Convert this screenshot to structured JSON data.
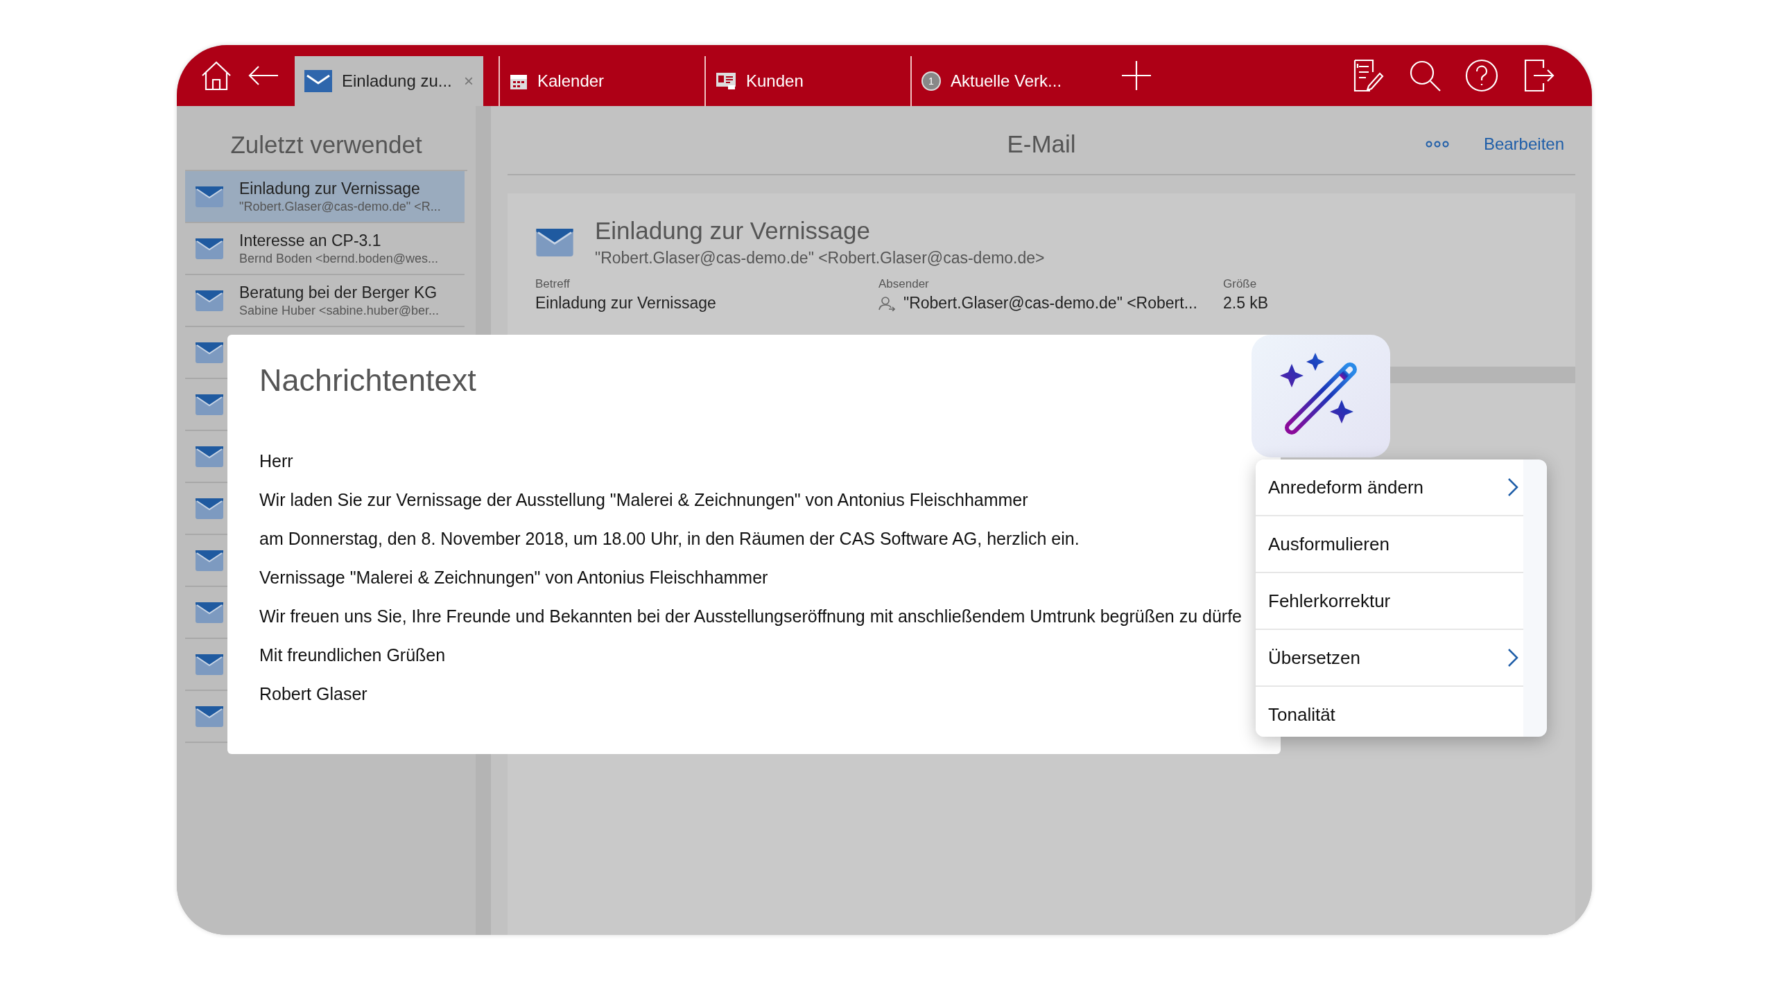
{
  "topbar": {
    "tabs": [
      {
        "label": "Einladung zu...",
        "kind": "mail",
        "selected": true,
        "close": "×"
      },
      {
        "label": "Kalender",
        "kind": "calendar",
        "selected": false
      },
      {
        "label": "Kunden",
        "kind": "card",
        "selected": false
      },
      {
        "label": "Aktuelle Verk...",
        "kind": "badge",
        "badge": "1",
        "selected": false
      }
    ]
  },
  "sidebar": {
    "title": "Zuletzt verwendet",
    "items": [
      {
        "title": "Einladung zur Vernissage",
        "subtitle": "\"Robert.Glaser@cas-demo.de\" <R...",
        "selected": true
      },
      {
        "title": "Interesse an CP-3.1",
        "subtitle": "Bernd Boden <bernd.boden@wes...",
        "selected": false
      },
      {
        "title": "Beratung bei der Berger KG",
        "subtitle": "Sabine Huber <sabine.huber@ber...",
        "selected": false
      },
      {
        "selected": false
      },
      {
        "selected": false
      },
      {
        "selected": false
      },
      {
        "selected": false
      },
      {
        "selected": false
      },
      {
        "selected": false
      },
      {
        "selected": false
      },
      {
        "selected": false
      }
    ]
  },
  "main": {
    "title": "E-Mail",
    "edit_link": "Bearbeiten",
    "card": {
      "title": "Einladung zur Vernissage",
      "from": "\"Robert.Glaser@cas-demo.de\" <Robert.Glaser@cas-demo.de>",
      "fields": [
        {
          "label": "Betreff",
          "value": "Einladung zur Vernissage",
          "kind": "text"
        },
        {
          "label": "Absender",
          "value": "\"Robert.Glaser@cas-demo.de\" <Robert...",
          "kind": "person"
        },
        {
          "label": "Größe",
          "value": "2.5 kB",
          "kind": "text"
        }
      ]
    }
  },
  "dialog": {
    "title": "Nachrichtentext",
    "lines": [
      "Herr",
      "Wir laden Sie zur Vernissage der Ausstellung \"Malerei & Zeichnungen\" von Antonius Fleischhammer",
      "am Donnerstag, den 8. November 2018, um 18.00 Uhr, in den Räumen der CAS Software AG, herzlich ein.",
      "Vernissage \"Malerei & Zeichnungen\" von Antonius Fleischhammer",
      "Wir freuen uns Sie, Ihre Freunde und Bekannten bei der Ausstellungseröffnung mit anschließendem Umtrunk begrüßen zu dürfe",
      "Mit freundlichen Grüßen",
      "Robert Glaser"
    ]
  },
  "ai_menu": {
    "items": [
      {
        "label": "Anredeform ändern",
        "submenu": true
      },
      {
        "label": "Ausformulieren",
        "submenu": false
      },
      {
        "label": "Fehlerkorrektur",
        "submenu": false
      },
      {
        "label": "Übersetzen",
        "submenu": true
      },
      {
        "label": "Tonalität",
        "submenu": false
      }
    ]
  }
}
